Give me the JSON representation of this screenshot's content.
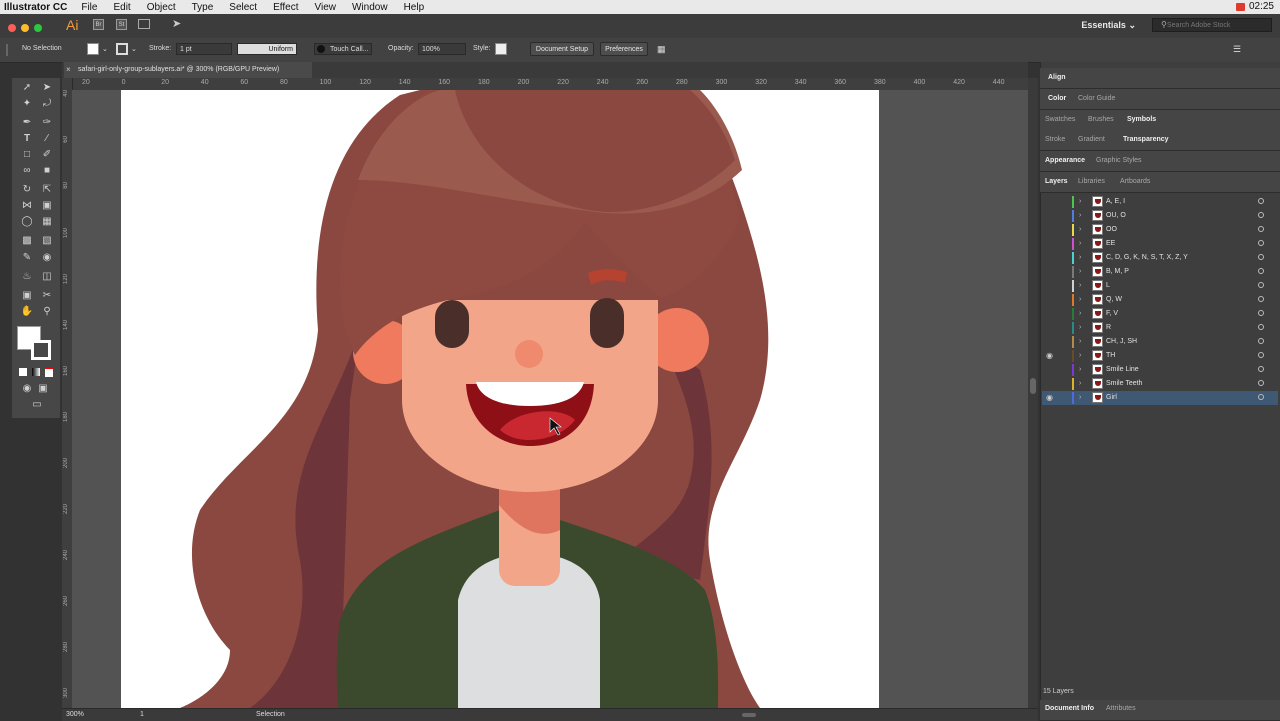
{
  "menubar": {
    "app_name": "Illustrator CC",
    "items": [
      "File",
      "Edit",
      "Object",
      "Type",
      "Select",
      "Effect",
      "View",
      "Window",
      "Help"
    ],
    "clock": "02:25"
  },
  "appbar": {
    "logo": "Ai",
    "bridge": "Br",
    "stock": "St",
    "workspace": "Essentials",
    "search_placeholder": "Search Adobe Stock"
  },
  "control_bar": {
    "selection": "No Selection",
    "stroke_label": "Stroke:",
    "stroke_weight": "1 pt",
    "stroke_profile": "Uniform",
    "brush": "Touch Call...",
    "opacity_label": "Opacity:",
    "opacity_value": "100%",
    "style_label": "Style:",
    "document_setup": "Document Setup",
    "preferences": "Preferences"
  },
  "document": {
    "tab_title": "safari-girl-only-group-sublayers.ai* @ 300% (RGB/GPU Preview)",
    "ruler_h": [
      "20",
      "0",
      "20",
      "40",
      "60",
      "80",
      "100",
      "120",
      "140",
      "160",
      "180",
      "200",
      "220",
      "240",
      "260",
      "280",
      "300",
      "320",
      "340",
      "360",
      "380",
      "400",
      "420",
      "440"
    ],
    "ruler_v": [
      "40",
      "60",
      "80",
      "100",
      "120",
      "140",
      "160",
      "180",
      "200",
      "220",
      "240",
      "260",
      "280",
      "300"
    ]
  },
  "status_bar": {
    "zoom": "300%",
    "artboard": "1",
    "tool": "Selection"
  },
  "panels": {
    "row1": [
      "Align"
    ],
    "row2": [
      "Color",
      "Color Guide"
    ],
    "row3": [
      "Swatches",
      "Brushes",
      "Symbols"
    ],
    "row4": [
      "Stroke",
      "Gradient",
      "Transparency"
    ],
    "row5": [
      "Appearance",
      "Graphic Styles"
    ],
    "layers_tabs": [
      "Layers",
      "Libraries",
      "Artboards"
    ],
    "layers": [
      {
        "name": "A, E, I",
        "color": "#4fc24f"
      },
      {
        "name": "OU, O",
        "color": "#4f7de0"
      },
      {
        "name": "OO",
        "color": "#e8d84a"
      },
      {
        "name": "EE",
        "color": "#d04fd0"
      },
      {
        "name": "C, D, G, K, N, S, T, X, Z, Y",
        "color": "#4fd0d0"
      },
      {
        "name": "B, M, P",
        "color": "#7a7a7a"
      },
      {
        "name": "L",
        "color": "#d0d0d0"
      },
      {
        "name": "Q, W",
        "color": "#e0782a"
      },
      {
        "name": "F, V",
        "color": "#2a7a3a"
      },
      {
        "name": "R",
        "color": "#2a8a8a"
      },
      {
        "name": "CH, J, SH",
        "color": "#b88a4a"
      },
      {
        "name": "TH",
        "color": "#6a4a2a"
      },
      {
        "name": "Smile Line",
        "color": "#7a3ad0"
      },
      {
        "name": "Smile Teeth",
        "color": "#e0b02a"
      },
      {
        "name": "Girl",
        "color": "#4f6ae0"
      }
    ],
    "layers_count": "15 Layers",
    "bottom_tabs": [
      "Document Info",
      "Attributes"
    ]
  },
  "colors": {
    "accent_logo": "#f29b35",
    "hair": "#8a4840",
    "skin": "#f2a589",
    "jacket": "#3b4a2c",
    "shirt": "#dcdedf",
    "mouth": "#8e1016",
    "selected_layer": "#3f5874"
  }
}
